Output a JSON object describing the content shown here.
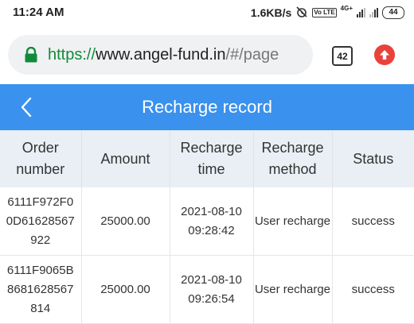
{
  "status_bar": {
    "time": "11:24 AM",
    "speed": "1.6KB/s",
    "network": "4G+",
    "volte": "Vo LTE",
    "battery": "44",
    "icons": [
      "alarm-off-icon",
      "volte-icon",
      "signal-icon",
      "signal-icon",
      "battery-icon"
    ]
  },
  "browser": {
    "url_scheme": "https://",
    "url_host": "www.angel-fund.in",
    "url_path": "/#/page",
    "tab_count": "42",
    "lock_color": "#128a3b",
    "update_color": "#e8423a"
  },
  "header": {
    "title": "Recharge record",
    "background": "#3a91ee"
  },
  "table": {
    "columns": [
      "Order number",
      "Amount",
      "Recharge time",
      "Recharge method",
      "Status"
    ],
    "rows": [
      {
        "order_number": "6111F972F00D61628567922",
        "amount": "25000.00",
        "recharge_time": "2021-08-10 09:28:42",
        "recharge_method": "User recharge",
        "status": "success"
      },
      {
        "order_number": "6111F9065B8681628567814",
        "amount": "25000.00",
        "recharge_time": "2021-08-10 09:26:54",
        "recharge_method": "User recharge",
        "status": "success"
      }
    ]
  }
}
